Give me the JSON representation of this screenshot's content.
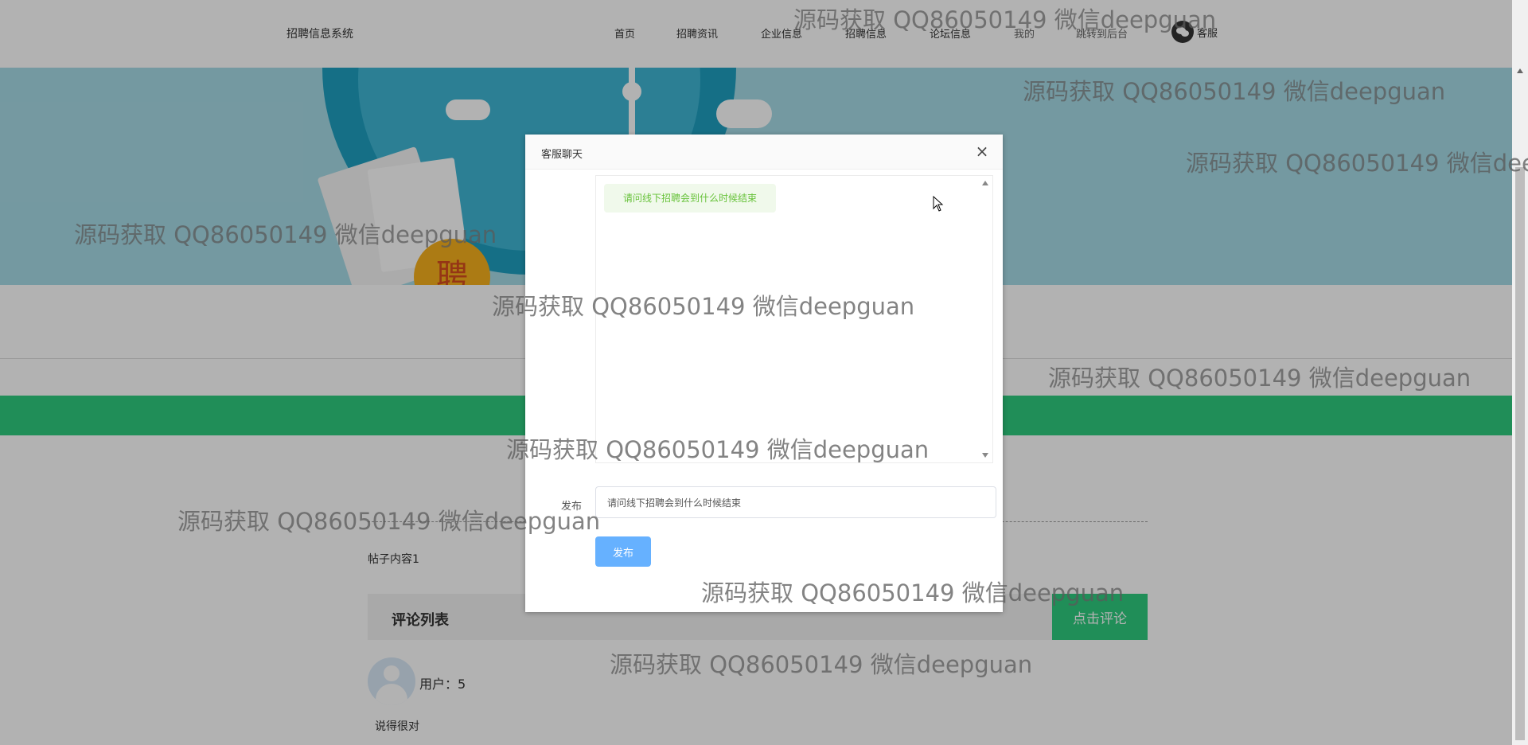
{
  "header": {
    "brand": "招聘信息系统",
    "nav": [
      {
        "label": "首页"
      },
      {
        "label": "招聘资讯"
      },
      {
        "label": "企业信息"
      },
      {
        "label": "招聘信息"
      },
      {
        "label": "论坛信息"
      },
      {
        "label": "我的"
      },
      {
        "label": "跳转到后台"
      }
    ],
    "customer_service_label": "客服"
  },
  "banner": {
    "seal_text": "聘"
  },
  "post": {
    "content": "帖子内容1"
  },
  "comments": {
    "title": "评论列表",
    "add_button": "点击评论",
    "items": [
      {
        "user": "用户：5",
        "text": "说得很对"
      }
    ]
  },
  "modal": {
    "title": "客服聊天",
    "close_symbol": "×",
    "messages": [
      {
        "text": "请问线下招聘会到什么时候结束"
      }
    ],
    "form_label": "发布",
    "input_value": "请问线下招聘会到什么时候结束",
    "publish_button": "发布"
  },
  "watermark": {
    "text": "源码获取 QQ86050149 微信deepguan"
  },
  "colors": {
    "accent_green": "#2ecc7f",
    "primary_blue": "#66b1ff",
    "message_green": "#67c23a",
    "banner_blue": "#a7dbe7"
  }
}
